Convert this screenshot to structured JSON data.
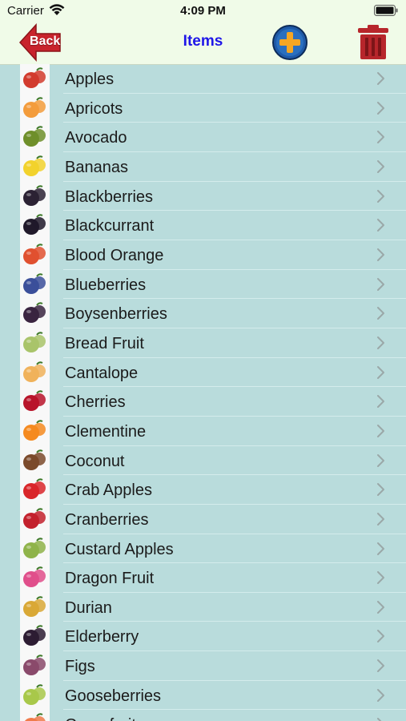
{
  "status_bar": {
    "carrier": "Carrier",
    "time": "4:09 PM"
  },
  "nav": {
    "back_label": "Back",
    "title": "Items"
  },
  "colors": {
    "background": "#b9dcdc",
    "nav_bg": "#f0fbe8",
    "title": "#1f16e8",
    "back_red": "#c8232c",
    "trash_red": "#b7262b",
    "add_blue": "#1f5aa8",
    "add_plus": "#f5a623"
  },
  "items": [
    {
      "label": "Apples",
      "color": "#d23b2e"
    },
    {
      "label": "Apricots",
      "color": "#f39c3c"
    },
    {
      "label": "Avocado",
      "color": "#6f8f2a"
    },
    {
      "label": "Bananas",
      "color": "#f2d22d"
    },
    {
      "label": "Blackberries",
      "color": "#2c2234"
    },
    {
      "label": "Blackcurrant",
      "color": "#20192a"
    },
    {
      "label": "Blood Orange",
      "color": "#e0502f"
    },
    {
      "label": "Blueberries",
      "color": "#3b4f9a"
    },
    {
      "label": "Boysenberries",
      "color": "#3a2440"
    },
    {
      "label": "Bread Fruit",
      "color": "#a9c46a"
    },
    {
      "label": "Cantalope",
      "color": "#f0b25b"
    },
    {
      "label": "Cherries",
      "color": "#b8142a"
    },
    {
      "label": "Clementine",
      "color": "#f58a1f"
    },
    {
      "label": "Coconut",
      "color": "#7b4a2b"
    },
    {
      "label": "Crab Apples",
      "color": "#d9262a"
    },
    {
      "label": "Cranberries",
      "color": "#c3212d"
    },
    {
      "label": "Custard Apples",
      "color": "#8fb34a"
    },
    {
      "label": "Dragon Fruit",
      "color": "#e04f8b"
    },
    {
      "label": "Durian",
      "color": "#d9a836"
    },
    {
      "label": "Elderberry",
      "color": "#2d1c33"
    },
    {
      "label": "Figs",
      "color": "#8a4a6b"
    },
    {
      "label": "Gooseberries",
      "color": "#a8c84a"
    },
    {
      "label": "Grapefruit",
      "color": "#f07a4a"
    }
  ]
}
